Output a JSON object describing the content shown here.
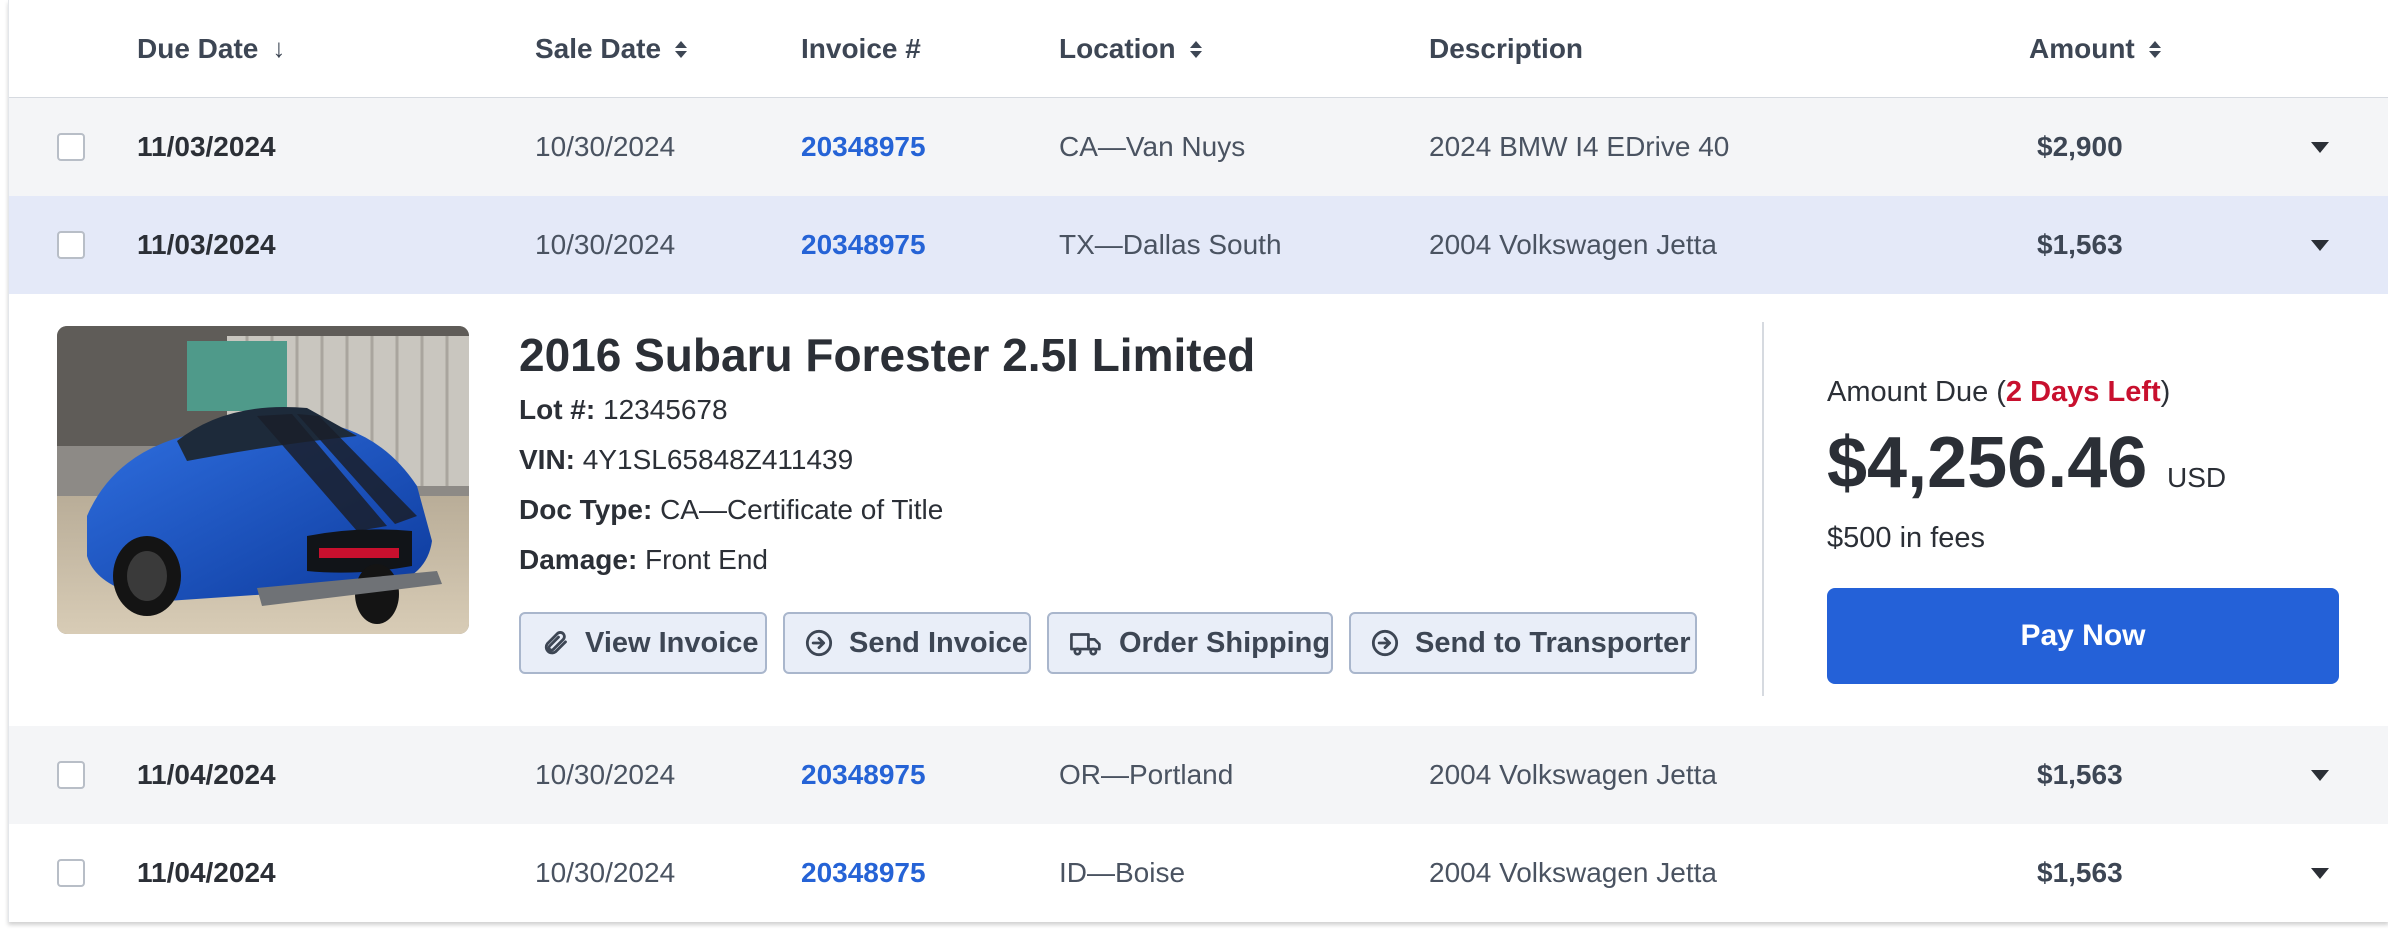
{
  "headers": {
    "due_date": "Due Date",
    "sale_date": "Sale Date",
    "invoice": "Invoice #",
    "location": "Location",
    "description": "Description",
    "amount": "Amount"
  },
  "rows": [
    {
      "due": "11/03/2024",
      "sale": "10/30/2024",
      "invoice": "20348975",
      "location": "CA—Van Nuys",
      "description": "2024 BMW I4 EDrive 40",
      "amount": "$2,900"
    },
    {
      "due": "11/03/2024",
      "sale": "10/30/2024",
      "invoice": "20348975",
      "location": "TX—Dallas South",
      "description": "2004 Volkswagen Jetta",
      "amount": "$1,563"
    },
    {
      "due": "11/04/2024",
      "sale": "10/30/2024",
      "invoice": "20348975",
      "location": "OR—Portland",
      "description": "2004 Volkswagen Jetta",
      "amount": "$1,563"
    },
    {
      "due": "11/04/2024",
      "sale": "10/30/2024",
      "invoice": "20348975",
      "location": "ID—Boise",
      "description": "2004 Volkswagen Jetta",
      "amount": "$1,563"
    }
  ],
  "detail": {
    "title": "2016 Subaru Forester 2.5I Limited",
    "lot_label": "Lot #:",
    "lot": "12345678",
    "vin_label": "VIN:",
    "vin": "4Y1SL65848Z411439",
    "doc_label": "Doc Type:",
    "doc": "CA—Certificate of Title",
    "damage_label": "Damage:",
    "damage": "Front End",
    "buttons": {
      "view_invoice": "View Invoice",
      "send_invoice": "Send Invoice",
      "order_shipping": "Order Shipping",
      "send_transporter": "Send to Transporter"
    },
    "amount_due_label": "Amount Due (",
    "days_left": "2 Days Left",
    "amount_due_close": ")",
    "amount": "$4,256.46",
    "currency": "USD",
    "fees": "$500 in fees",
    "pay_label": "Pay Now"
  },
  "icons": {
    "sort": "sort-icon",
    "arrow_down": "arrow-down-icon",
    "caret": "chevron-down-icon",
    "paperclip": "paperclip-icon",
    "send": "send-icon",
    "truck": "truck-icon"
  },
  "colors": {
    "link": "#2563d6",
    "accent": "#2461d8",
    "warning": "#c8102e",
    "selected_row": "#e4e9f8",
    "striped_row": "#f4f5f7"
  }
}
